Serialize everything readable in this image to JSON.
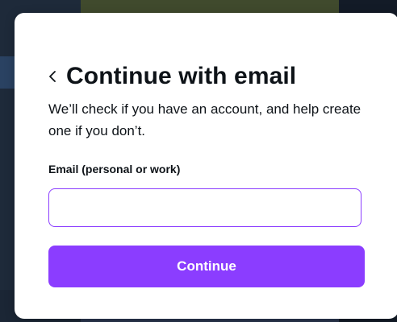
{
  "modal": {
    "title": "Continue with email",
    "description": "We’ll check if you have an account, and help create one if you don’t.",
    "email_label": "Email (personal or work)",
    "email_value": "",
    "email_placeholder": "",
    "continue_label": "Continue"
  },
  "icons": {
    "back": "chevron-left-icon"
  },
  "colors": {
    "accent": "#8b3dff",
    "text": "#0e1318",
    "modal_bg": "#ffffff"
  }
}
